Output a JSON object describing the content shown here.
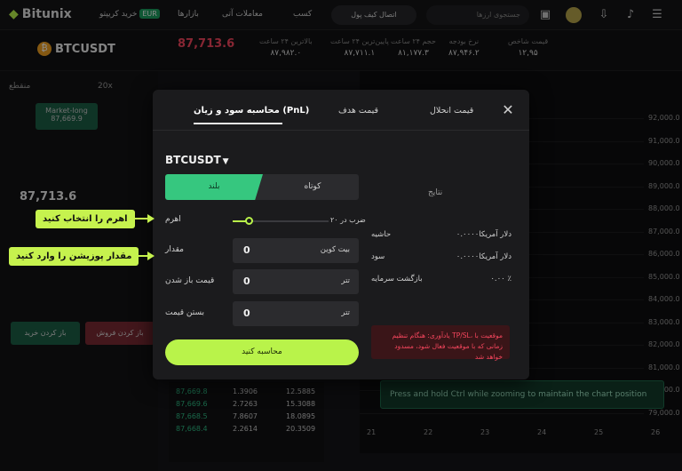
{
  "header": {
    "logo": "Bitunix",
    "nav": [
      "خرید کریپتو",
      "بازارها",
      "معاملات آتی",
      "کسب"
    ],
    "nav_badge": "EUR",
    "login_button": "اتصال کیف پول",
    "search_placeholder": "جستجوی ارزها"
  },
  "ticker": {
    "pair": "BTCUSDT",
    "price": "87,713.6",
    "stats": [
      {
        "label": "بالاترین ۲۴ ساعت",
        "value": "۸۷,۹۸۲.۰"
      },
      {
        "label": "پایین‌ترین ۲۴ ساعت",
        "value": "۸۷,۷۱۱.۱"
      },
      {
        "label": "حجم ۲۴ ساعت",
        "value": "۸۱,۱۷۷.۳"
      },
      {
        "label": "نرخ بودجه",
        "value": "۸۷,۹۴۶.۲"
      },
      {
        "label": "قیمت شاخص",
        "value": "۱۲,۹۵"
      }
    ]
  },
  "left_panel": {
    "mode": "منقطع",
    "leverage": "20x",
    "market_long_label": "Market-long",
    "market_long_price": "87,669.9",
    "ref_price": "87,713.6",
    "buy_button": "باز کردن خرید",
    "sell_button": "باز کردن فروش"
  },
  "chart": {
    "y_labels": [
      "92,000.0",
      "91,000.0",
      "90,000.0",
      "89,000.0",
      "88,000.0",
      "87,000.0",
      "86,000.0",
      "85,000.0",
      "84,000.0",
      "83,000.0",
      "82,000.0",
      "81,000.0",
      "80,000.0",
      "79,000.0"
    ],
    "x_labels": [
      "21",
      "22",
      "23",
      "24",
      "25",
      "26"
    ],
    "toast": "Press and hold Ctrl while zooming to maintain the chart position"
  },
  "orderbook": {
    "rows": [
      [
        "87,669.8",
        "1.3906",
        "12.5885"
      ],
      [
        "87,669.6",
        "2.7263",
        "15.3088"
      ],
      [
        "87,668.5",
        "7.8607",
        "18.0895"
      ],
      [
        "87,668.4",
        "2.2614",
        "20.3509"
      ]
    ]
  },
  "modal": {
    "tabs": {
      "pnl": "محاسبه سود و زیان (PnL)",
      "target": "قیمت هدف",
      "liquidation": "قیمت انحلال"
    },
    "symbol": "BTCUSDT",
    "long_label": "بلند",
    "short_label": "کوتاه",
    "leverage_label": "اهرم",
    "leverage_value": "۲۰ ضرب در",
    "quantity_label": "مقدار",
    "quantity_value": "0",
    "quantity_unit": "بیت کوین",
    "entry_label": "قیمت باز شدن",
    "entry_value": "0",
    "entry_unit": "تتر",
    "exit_label": "بستن قیمت",
    "exit_value": "0",
    "exit_unit": "تتر",
    "calc_button": "محاسبه کنید",
    "results": {
      "title": "نتایج",
      "margin_label": "حاشیه",
      "margin_value": "دلار آمریکا۰.۰۰۰۰",
      "profit_label": "سود",
      "profit_value": "دلار آمریکا۰.۰۰۰۰",
      "roi_label": "بازگشت سرمایه",
      "roi_value": "۰.۰۰ ٪"
    },
    "warning": "یادآوری: هنگام تنظیم TP/SL، موقعیت با زمانی که با موقعیت فعال شود، مسدود خواهد شد"
  },
  "callouts": {
    "leverage": "اهرم را انتخاب کنید",
    "quantity": "مقدار پوزیشن را وارد کنید"
  },
  "colors": {
    "accent": "#b9f34a",
    "long": "#36c77f",
    "danger": "#f6465d"
  }
}
